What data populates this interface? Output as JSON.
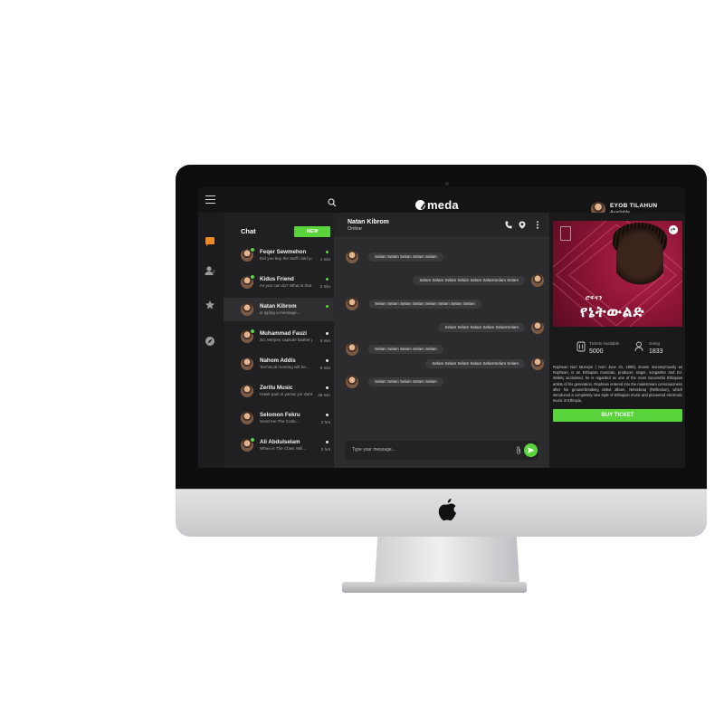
{
  "colors": {
    "accent": "#59d43b",
    "sidebar_bg": "#202022",
    "chat_bg": "#2c2c2e",
    "poster": "#8e1536"
  },
  "app": {
    "logo_text": "meda"
  },
  "profile": {
    "name": "EYOB TILAHUN",
    "status": "Available"
  },
  "chat_list": {
    "title": "Chat",
    "new_label": "NEW",
    "contacts": [
      {
        "name": "Feqer Sewmehon",
        "preview": "Did you buy the stuff i told you...",
        "time": "1 min",
        "status": "green",
        "badge": true
      },
      {
        "name": "Kidus Friend",
        "preview": "As you can do? What is that...",
        "time": "2 min",
        "status": "green",
        "badge": true
      },
      {
        "name": "Natan Kibrom",
        "preview": "is typing a message...",
        "time": "",
        "status": "green",
        "badge": false
      },
      {
        "name": "Muhammad Fauzi",
        "preview": "So, Merjem capsule basket yo...",
        "time": "9 min",
        "status": "white",
        "badge": true
      },
      {
        "name": "Nahom Addis",
        "preview": "Technical meeting will be...",
        "time": "9 min",
        "status": "white",
        "badge": false
      },
      {
        "name": "Zeritu Music",
        "preview": "Hawk pain si yamar yor dunk",
        "time": "45 min",
        "status": "white",
        "badge": false
      },
      {
        "name": "Selomon Fekru",
        "preview": "Send me The Code...",
        "time": "2 hrs",
        "status": "white",
        "badge": false
      },
      {
        "name": "Ali Abdulselam",
        "preview": "When is The Class Will...",
        "time": "2 hrs",
        "status": "white",
        "badge": true
      }
    ]
  },
  "conversation": {
    "contact_name": "Natan Kibrom",
    "contact_status": "Online",
    "messages": [
      {
        "side": "left",
        "text": "Selam Selam Selam Selam Selam"
      },
      {
        "side": "right",
        "text": "Selam Selam Selam Selam Selam SelamSelam Selam"
      },
      {
        "side": "left",
        "text": "Selam Selam Selam Selam Selam Selam Selam Selam"
      },
      {
        "side": "right",
        "text": "Selam Selam Selam Selam SelamSelam"
      },
      {
        "side": "left",
        "text": "Selam Selam Selam Selam Selam"
      },
      {
        "side": "right",
        "text": "Selam Selam Selam Selam SelamSelam Selam"
      },
      {
        "side": "left",
        "text": "Selam Selam Selam Selam Selam"
      }
    ],
    "input_placeholder": "Type your message..."
  },
  "event": {
    "poster_subtitle": "ሮፍናን",
    "poster_title": "የኔትውልድ",
    "tickets_label": "Tickets Available",
    "tickets_value": "5000",
    "going_label": "Going",
    "going_value": "1833",
    "description": "Rophnan Nuri Muzeyin ( born June 22, 1990), known mononymously as Rophnan, is an Ethiopian musician, producer, singer, songwriter and DJ. Widely acclaimed, he is regarded as one of the most successful Ethiopian artists of his generation. Rophnan entered into the mainstream consciousness after his ground-breaking debut album, Netsebraq (Reflection), which introduced a completely new style of Ethiopian music and pioneered electronic music in Ethiopia.",
    "buy_label": "BUY TICKET"
  }
}
